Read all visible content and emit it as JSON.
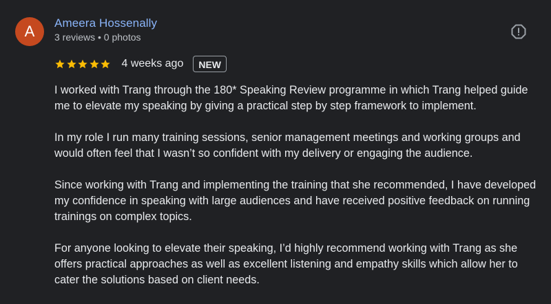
{
  "reviewer": {
    "avatar_letter": "A",
    "avatar_color": "#c5491f",
    "name": "Ameera Hossenally",
    "meta": "3 reviews • 0 photos"
  },
  "report_icon": "report-flag-icon",
  "review": {
    "rating": 5,
    "rating_max": 5,
    "star_color": "#fbbc04",
    "date": "4 weeks ago",
    "badge": "NEW",
    "paragraphs": [
      "I worked with Trang through the 180* Speaking Review programme in which Trang helped guide me to elevate my speaking by giving a practical step by step framework to implement.",
      "In my role I run many training sessions, senior management meetings and working groups and would often feel that I wasn’t so confident with my delivery or engaging the audience.",
      "Since working with Trang and implementing the training that she recommended, I have developed my confidence in speaking with large audiences and have received positive feedback on running trainings on complex topics.",
      "For anyone looking to elevate their speaking, I’d highly recommend working with Trang as she offers practical approaches as well as excellent listening and empathy skills which allow her to cater the solutions based on client needs."
    ]
  }
}
